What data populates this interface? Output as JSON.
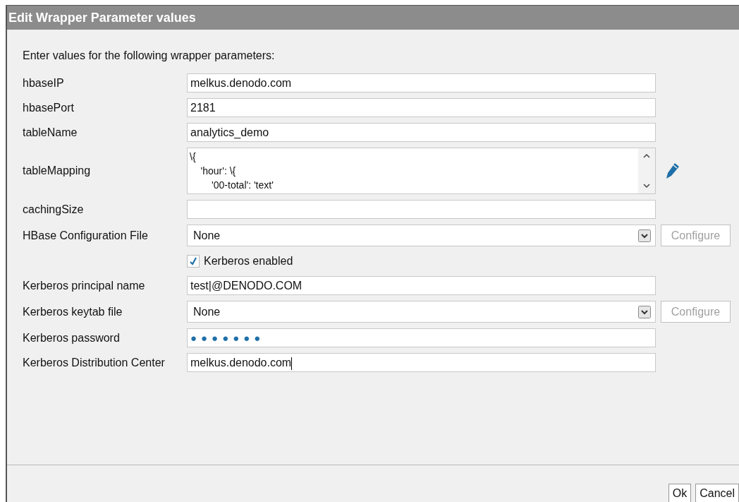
{
  "window": {
    "title": "Edit Wrapper Parameter values"
  },
  "intro": "Enter values for the following wrapper parameters:",
  "params": [
    {
      "kind": "text",
      "label": "hbaseIP",
      "value": "melkus.denodo.com"
    },
    {
      "kind": "text",
      "label": "hbasePort",
      "value": "2181"
    },
    {
      "kind": "text",
      "label": "tableName",
      "value": "analytics_demo"
    },
    {
      "kind": "textarea",
      "label": "tableMapping",
      "lines": [
        "\\{",
        "    'hour': \\{",
        "        '00-total': 'text'"
      ]
    },
    {
      "kind": "text",
      "label": "cachingSize"
    },
    {
      "kind": "select",
      "label": "HBase Configuration File",
      "value": "None",
      "button": "Configure",
      "button_disabled": true
    },
    {
      "kind": "checkbox",
      "label": "Kerberos enabled",
      "checked": true
    },
    {
      "kind": "text",
      "label": "Kerberos principal name",
      "value": "test|@DENODO.COM"
    },
    {
      "kind": "select",
      "label": "Kerberos keytab file",
      "value": "None",
      "button": "Configure",
      "button_disabled": true
    },
    {
      "kind": "password",
      "label": "Kerberos password",
      "value": "●●●●●●●"
    },
    {
      "kind": "text",
      "label": "Kerberos Distribution Center",
      "value": "melkus.denodo.com",
      "focused": true
    }
  ],
  "buttons": [
    "Ok",
    "Cancel"
  ]
}
